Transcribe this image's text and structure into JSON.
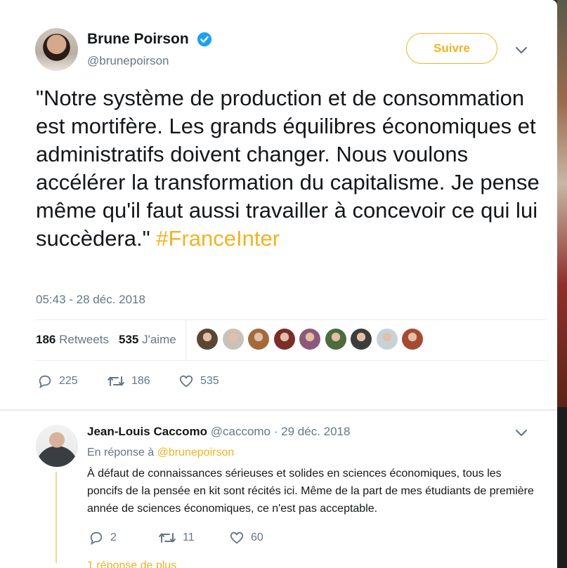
{
  "colors": {
    "accent": "#f0b323",
    "text": "#14171a",
    "muted": "#657786",
    "verified": "#1da1f2"
  },
  "main_tweet": {
    "author_name": "Brune Poirson",
    "author_handle": "@brunepoirson",
    "follow_label": "Suivre",
    "text": "\"Notre système de production et de consommation est mortifère. Les grands équilibres économiques et administratifs doivent changer. Nous voulons accélérer la transformation du capitalisme. Je pense même qu'il faut aussi travailler à concevoir ce qui lui succèdera.\" ",
    "hashtag": "#FranceInter",
    "timestamp": "05:43 - 28 déc. 2018",
    "retweets_count": "186",
    "retweets_label": "Retweets",
    "likes_count": "535",
    "likes_label": "J'aime",
    "likers": [
      "#5b4636",
      "#c9c2b8",
      "#a36a3c",
      "#7a2e2a",
      "#8c5a78",
      "#4e6b3c",
      "#3c3c3c",
      "#c7d2d8",
      "#a64a33"
    ],
    "actions": {
      "reply_count": "225",
      "retweet_count": "186",
      "like_count": "535"
    }
  },
  "reply": {
    "author_name": "Jean-Louis Caccomo",
    "author_handle": "@caccomo",
    "date": "· 29 déc. 2018",
    "context_prefix": "En réponse à",
    "context_mention": "@brunepoirson",
    "text": "À défaut de connaissances sérieuses et solides en sciences économiques, tous les poncifs de la pensée en kit sont récités ici. Même de la part de mes étudiants de première année de sciences économiques, ce n'est pas acceptable.",
    "actions": {
      "reply_count": "2",
      "retweet_count": "11",
      "like_count": "60"
    },
    "more_replies": "1 réponse de plus"
  }
}
